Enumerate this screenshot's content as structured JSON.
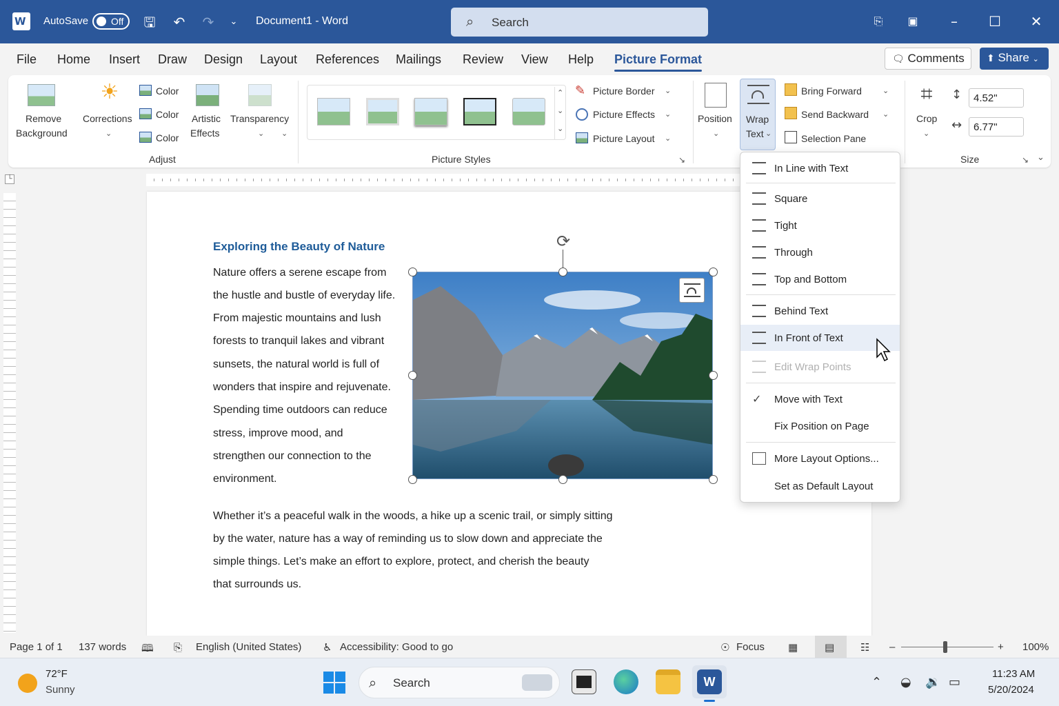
{
  "titlebar": {
    "autosave_label": "AutoSave",
    "autosave_state": "Off",
    "document_title": "Document1  -  Word",
    "search_placeholder": "Search"
  },
  "tabs": [
    "File",
    "Home",
    "Insert",
    "Draw",
    "Design",
    "Layout",
    "References",
    "Mailings",
    "Review",
    "View",
    "Help",
    "Picture Format"
  ],
  "active_tab": "Picture Format",
  "actions": {
    "comments": "Comments",
    "share": "Share"
  },
  "ribbon": {
    "adjust": {
      "remove_background_line1": "Remove",
      "remove_background_line2": "Background",
      "corrections": "Corrections",
      "color1": "Color",
      "color2": "Color",
      "color3": "Color",
      "artistic_line1": "Artistic",
      "artistic_line2": "Effects",
      "transparency": "Transparency",
      "group_label": "Adjust"
    },
    "picture_styles": {
      "group_label": "Picture Styles",
      "border": "Picture Border",
      "effects": "Picture Effects",
      "layout": "Picture Layout"
    },
    "arrange": {
      "position": "Position",
      "wrap_line1": "Wrap",
      "wrap_line2": "Text",
      "bring_forward": "Bring Forward",
      "send_backward": "Send Backward",
      "selection_pane": "Selection Pane"
    },
    "size": {
      "crop": "Crop",
      "height": "4.52\"",
      "width": "6.77\"",
      "group_label": "Size"
    }
  },
  "document": {
    "heading": "Exploring the Beauty of Nature",
    "para1_lines": [
      "Nature offers a serene escape from",
      "the hustle and bustle of everyday life.",
      "From majestic mountains and lush",
      "forests to tranquil lakes and vibrant",
      "sunsets, the natural world is full of",
      "wonders that inspire and rejuvenate.",
      "Spending time outdoors can reduce",
      "stress, improve mood, and",
      "strengthen our connection to the",
      "environment."
    ],
    "para2_lines": [
      "Whether it’s a peaceful walk in the woods, a hike up a scenic trail, or simply sitting",
      "by the water, nature has a way of reminding us to slow down and appreciate the",
      "simple things. Let’s make an effort to explore, protect, and cherish the beauty",
      "that surrounds us."
    ]
  },
  "wrap_menu": {
    "inline": "In Line with Text",
    "square": "Square",
    "tight": "Tight",
    "through": "Through",
    "top_bottom": "Top and Bottom",
    "behind": "Behind Text",
    "in_front": "In Front of Text",
    "edit_wrap": "Edit Wrap Points",
    "move_with_text": "Move with Text",
    "fix_position": "Fix Position on Page",
    "more_layout": "More Layout Options...",
    "set_default": "Set as Default Layout"
  },
  "statusbar": {
    "page": "Page 1 of 1",
    "words": "137 words",
    "language": "English (United States)",
    "accessibility": "Accessibility: Good to go",
    "focus": "Focus",
    "zoom": "100%"
  },
  "taskbar": {
    "temperature": "72°F",
    "condition": "Sunny",
    "search": "Search",
    "time": "11:23 AM",
    "date": "5/20/2024"
  },
  "colors": {
    "accent": "#2b579a",
    "heading": "#1f5c99"
  }
}
